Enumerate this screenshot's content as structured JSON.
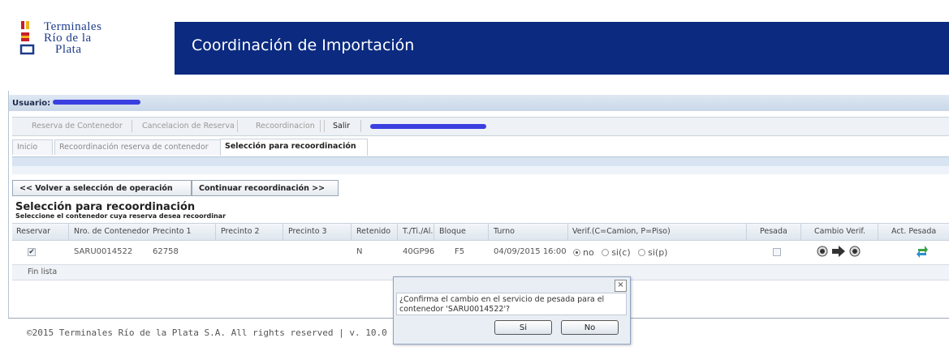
{
  "logo": {
    "line1": "Terminales",
    "line2": "Río de la",
    "line3": "Plata"
  },
  "header": {
    "title": "Coordinación de Importación"
  },
  "user": {
    "label": "Usuario:"
  },
  "menu": {
    "items": [
      "Reserva de Contenedor",
      "Cancelacion de Reserva",
      "Recoordinacion",
      "Salir"
    ]
  },
  "tabs": [
    {
      "label": "Inicio"
    },
    {
      "label": "Recoordinación reserva de contenedor"
    },
    {
      "label": "Selección para recoordinación"
    }
  ],
  "nav": {
    "back": "<< Volver a selección de operación",
    "continue": "Continuar recoordinación >>"
  },
  "section": {
    "title": "Selección para recoordinación",
    "subtitle": "Seleccione el contenedor cuya reserva desea recoordinar"
  },
  "table": {
    "headers": [
      "Reservar",
      "Nro. de Contenedor",
      "Precinto 1",
      "Precinto 2",
      "Precinto 3",
      "Retenido",
      "T./Ti./Al.",
      "Bloque",
      "Turno",
      "Verif.(C=Camion, P=Piso)",
      "Pesada",
      "Cambio Verif.",
      "Act. Pesada"
    ],
    "row": {
      "reservar": true,
      "contenedor": "SARU0014522",
      "precinto1": "62758",
      "precinto2": "",
      "precinto3": "",
      "retenido": "N",
      "tipo": "40GP96",
      "bloque": "F5",
      "turno": "04/09/2015 16:00",
      "verif_options": [
        "no",
        "si(c)",
        "si(p)"
      ],
      "verif_selected": "no",
      "pesada": false
    },
    "end_label": "Fin lista"
  },
  "dialog": {
    "close": "×",
    "message": "¿Confirma el cambio en el servicio de pesada para el contenedor 'SARU0014522'?",
    "yes": "Si",
    "no": "No"
  },
  "footer": {
    "text": "©2015 Terminales Río de la Plata S.A. All rights reserved | v. 10.0"
  },
  "colors": {
    "header": "#0b2a80",
    "redaction": "#3a3fe0",
    "refresh_green": "#3aa14a"
  }
}
